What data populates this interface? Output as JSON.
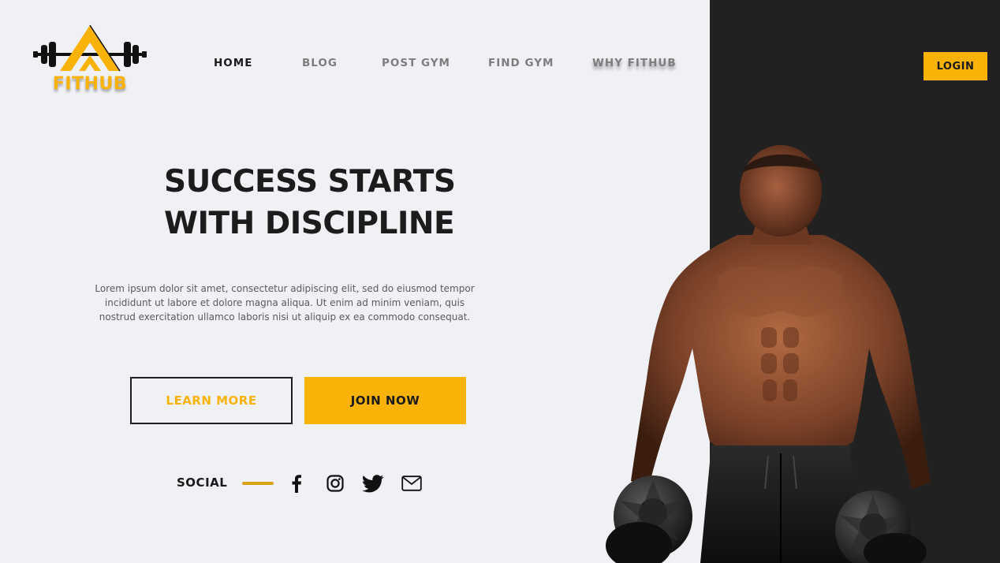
{
  "brand": {
    "name": "FITHUB",
    "accent": "#f9b208",
    "dark": "#212121",
    "background": "#f0f1f5"
  },
  "nav": {
    "items": [
      {
        "label": "HOME",
        "active": true
      },
      {
        "label": "BLOG",
        "active": false
      },
      {
        "label": "POST GYM",
        "active": false
      },
      {
        "label": "FIND GYM",
        "active": false
      },
      {
        "label": "WHY FITHUB",
        "active": false
      }
    ],
    "login_label": "LOGIN"
  },
  "hero": {
    "title_line1": "SUCCESS STARTS",
    "title_line2": "WITH DISCIPLINE",
    "description": "Lorem ipsum dolor sit amet, consectetur adipiscing elit, sed do eiusmod tempor incididunt ut labore et dolore magna aliqua. Ut enim ad minim veniam, quis nostrud exercitation ullamco laboris nisi ut aliquip ex ea commodo consequat.",
    "learn_more_label": "LEARN MORE",
    "join_now_label": "JOIN NOW"
  },
  "social": {
    "label": "SOCIAL",
    "icons": [
      "facebook-icon",
      "instagram-icon",
      "twitter-icon",
      "mail-icon"
    ]
  },
  "image": {
    "subject": "muscular-man-with-dumbbells"
  }
}
